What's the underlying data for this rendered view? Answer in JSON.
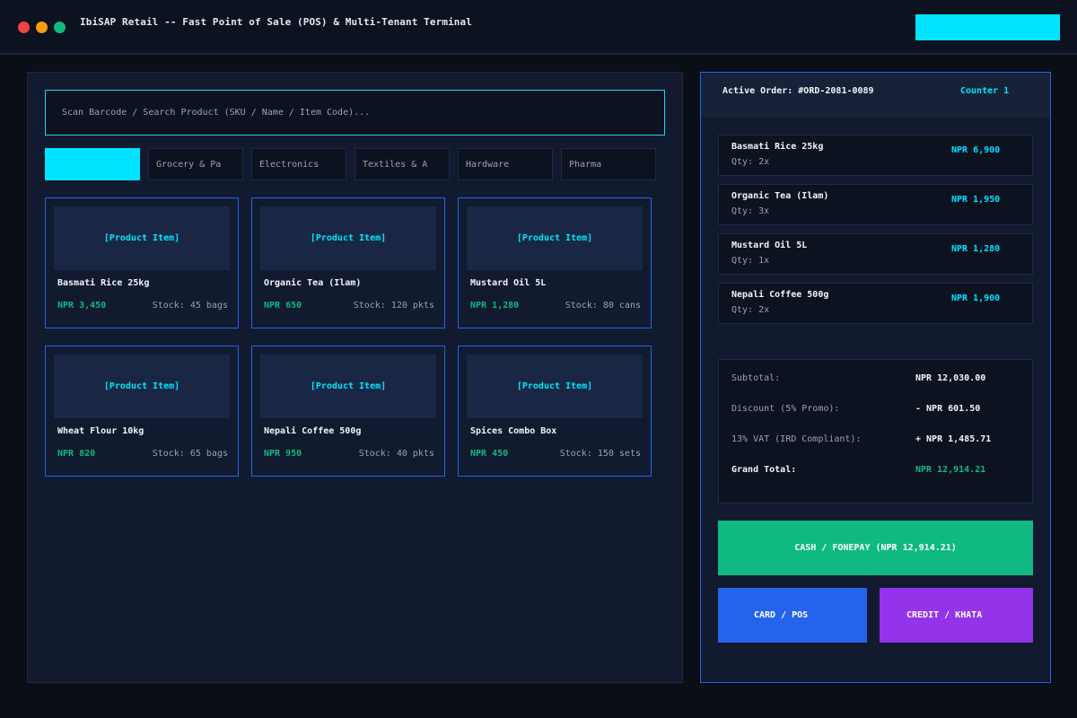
{
  "window": {
    "title": "IbiSAP Retail -- Fast Point of Sale (POS) & Multi-Tenant Terminal"
  },
  "search": {
    "placeholder": "Scan Barcode / Search Product (SKU / Name / Item Code)..."
  },
  "categories": [
    {
      "label": "",
      "active": true
    },
    {
      "label": "Grocery & Pa",
      "active": false
    },
    {
      "label": "Electronics",
      "active": false
    },
    {
      "label": "Textiles & A",
      "active": false
    },
    {
      "label": "Hardware",
      "active": false
    },
    {
      "label": "Pharma",
      "active": false
    }
  ],
  "products": [
    {
      "image_label": "[Product Item]",
      "name": "Basmati Rice 25kg",
      "price": "NPR 3,450",
      "stock": "Stock: 45 bags"
    },
    {
      "image_label": "[Product Item]",
      "name": "Organic Tea (Ilam)",
      "price": "NPR 650",
      "stock": "Stock: 120 pkts"
    },
    {
      "image_label": "[Product Item]",
      "name": "Mustard Oil 5L",
      "price": "NPR 1,280",
      "stock": "Stock: 80 cans"
    },
    {
      "image_label": "[Product Item]",
      "name": "Wheat Flour 10kg",
      "price": "NPR 820",
      "stock": "Stock: 65 bags"
    },
    {
      "image_label": "[Product Item]",
      "name": "Nepali Coffee 500g",
      "price": "NPR 950",
      "stock": "Stock: 40 pkts"
    },
    {
      "image_label": "[Product Item]",
      "name": "Spices Combo Box",
      "price": "NPR 450",
      "stock": "Stock: 150 sets"
    }
  ],
  "order": {
    "label": "Active Order: #ORD-2081-0089",
    "counter": "Counter 1",
    "lines": [
      {
        "name": "Basmati Rice 25kg",
        "qty": "Qty: 2x",
        "price": "NPR 6,900"
      },
      {
        "name": "Organic Tea (Ilam)",
        "qty": "Qty: 3x",
        "price": "NPR 1,950"
      },
      {
        "name": "Mustard Oil 5L",
        "qty": "Qty: 1x",
        "price": "NPR 1,280"
      },
      {
        "name": "Nepali Coffee 500g",
        "qty": "Qty: 2x",
        "price": "NPR 1,900"
      }
    ]
  },
  "totals": {
    "subtotal_label": "Subtotal:",
    "subtotal_value": "NPR 12,030.00",
    "discount_label": "Discount (5% Promo):",
    "discount_value": "- NPR 601.50",
    "vat_label": "13% VAT (IRD Compliant):",
    "vat_value": "+ NPR 1,485.71",
    "grand_label": "Grand Total:",
    "grand_value": "NPR 12,914.21"
  },
  "payment": {
    "cash_label": "CASH / FONEPAY (NPR 12,914.21)",
    "card_label": "CARD / POS",
    "credit_label": "CREDIT / KHATA"
  },
  "colors": {
    "accent": "#00e5ff",
    "success": "#10b981",
    "primary": "#2563eb",
    "purple": "#9333ea",
    "background": "#0a0e17"
  }
}
